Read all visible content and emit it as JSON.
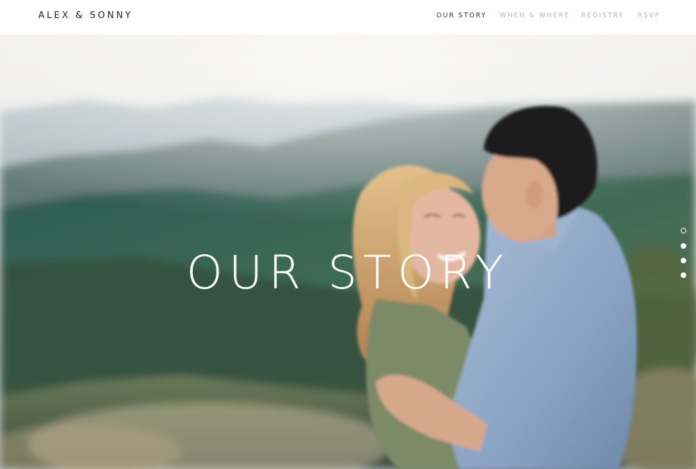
{
  "brand": "ALEX & SONNY",
  "nav": {
    "items": [
      {
        "label": "OUR STORY",
        "active": true
      },
      {
        "label": "WHEN & WHERE",
        "active": false
      },
      {
        "label": "REGISTRY",
        "active": false
      },
      {
        "label": "RSVP",
        "active": false
      }
    ]
  },
  "hero": {
    "title": "OUR STORY",
    "photo_subject": "couple embracing on a mountain overlook"
  },
  "section_dots": {
    "count": 4,
    "active_index": 0
  },
  "colors": {
    "nav_active": "#333333",
    "nav_inactive": "#b9b9b9",
    "title": "#ffffff"
  }
}
